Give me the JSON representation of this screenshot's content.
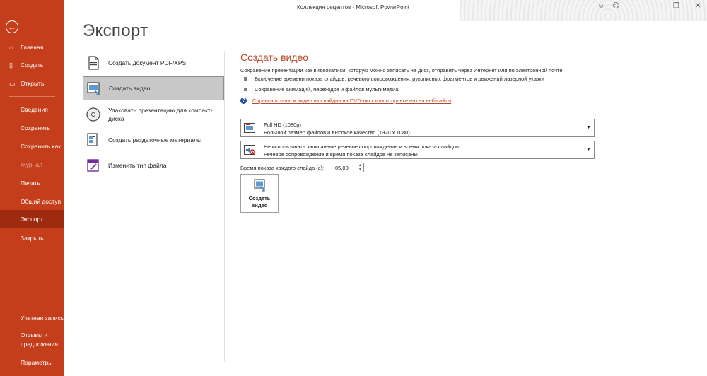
{
  "window": {
    "title": "Коллекция рецептов  -  Microsoft PowerPoint",
    "controls": {
      "minimize": "‒",
      "restore": "❐",
      "close": "✕",
      "smile": "☺",
      "frown": "☹"
    }
  },
  "sidebar": {
    "back_icon": "←",
    "items": [
      {
        "label": "Главная",
        "icon": "⌂"
      },
      {
        "label": "Создать",
        "icon": "▯"
      },
      {
        "label": "Открыть",
        "icon": "▭"
      },
      {
        "label": "Сведения"
      },
      {
        "label": "Сохранить"
      },
      {
        "label": "Сохранить как"
      },
      {
        "label": "Журнал"
      },
      {
        "label": "Печать"
      },
      {
        "label": "Общий доступ"
      },
      {
        "label": "Экспорт"
      },
      {
        "label": "Закрыть"
      },
      {
        "label": "Учетная запись"
      },
      {
        "label": "Отзывы и предложения"
      },
      {
        "label": "Параметры"
      }
    ],
    "active": "Экспорт",
    "accent": "#c43e1c"
  },
  "page": {
    "title": "Экспорт"
  },
  "export_options": [
    {
      "label": "Создать документ PDF/XPS",
      "icon": "pdf-document-icon"
    },
    {
      "label": "Создать видео",
      "icon": "video-icon",
      "selected": true
    },
    {
      "label": "Упаковать презентацию для компакт-диска",
      "icon": "cd-icon"
    },
    {
      "label": "Создать раздаточные материалы",
      "icon": "handouts-icon"
    },
    {
      "label": "Изменить тип файла",
      "icon": "change-file-type-icon"
    }
  ],
  "video": {
    "heading": "Создать видео",
    "description": "Сохранение презентации как видеозаписи, которую можно записать на диск, отправить через Интернет или по электронной почте",
    "bullets": [
      "Включение времени показа слайдов, речевого сопровождения, рукописных фрагментов и движений лазерной указки",
      "Сохранение анимаций, переходов и файлов мультимедиа"
    ],
    "help_link": "Справка о записи видео из слайдов на DVD-диск или отправке его на веб-сайты",
    "quality": {
      "title": "Full HD (1080p)",
      "subtitle": "Большой размер файлов и высокое качество (1920 x 1080)"
    },
    "narration": {
      "title": "Не использовать записанные речевое сопровождение и время показа слайдов",
      "subtitle": "Речевое сопровождение и время показа слайдов не записаны"
    },
    "seconds_label": "Время показа каждого слайда (с):",
    "seconds_value": "05,00",
    "create_button": "Создать видео"
  }
}
